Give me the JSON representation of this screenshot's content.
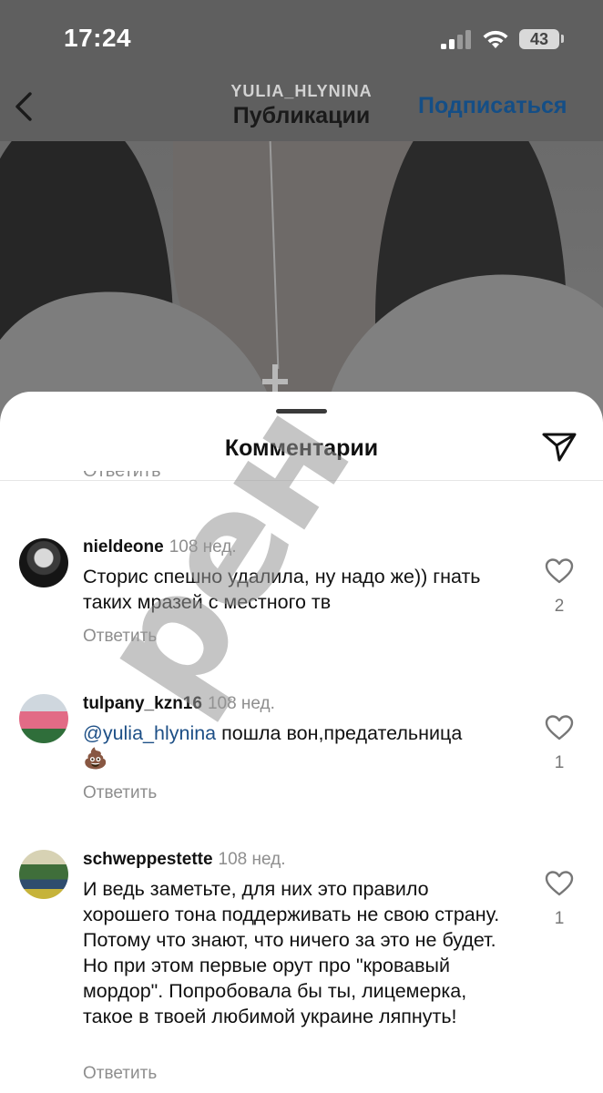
{
  "status_bar": {
    "time": "17:24",
    "battery": "43"
  },
  "header": {
    "username": "YULIA_HLYNINA",
    "title": "Публикации",
    "follow_label": "Подписаться"
  },
  "sheet": {
    "title": "Комментарии",
    "partial_reply_label": "Ответить"
  },
  "comments": [
    {
      "username": "nieldeone",
      "time": "108 нед.",
      "text": "Сторис спешно удалила, ну надо же)) гнать таких мразей с местного тв",
      "reply_label": "Ответить",
      "likes": "2"
    },
    {
      "username": "tulpany_kzn16",
      "time": "108 нед.",
      "mention": "@yulia_hlynina",
      "text": " пошла вон,предательница",
      "emoji": "💩",
      "reply_label": "Ответить",
      "likes": "1"
    },
    {
      "username": "schweppestette",
      "time": "108 нед.",
      "text": "И ведь заметьте, для них это правило хорошего тона поддерживать не свою страну. Потому что знают, что ничего за это не будет. Но при этом первые орут про \"кровавый мордор\". Попробовала бы ты, лицемерка, такое в твоей любимой украине ляпнуть!",
      "reply_label": "Ответить",
      "likes": "1"
    }
  ],
  "watermark": {
    "text": "рен"
  }
}
